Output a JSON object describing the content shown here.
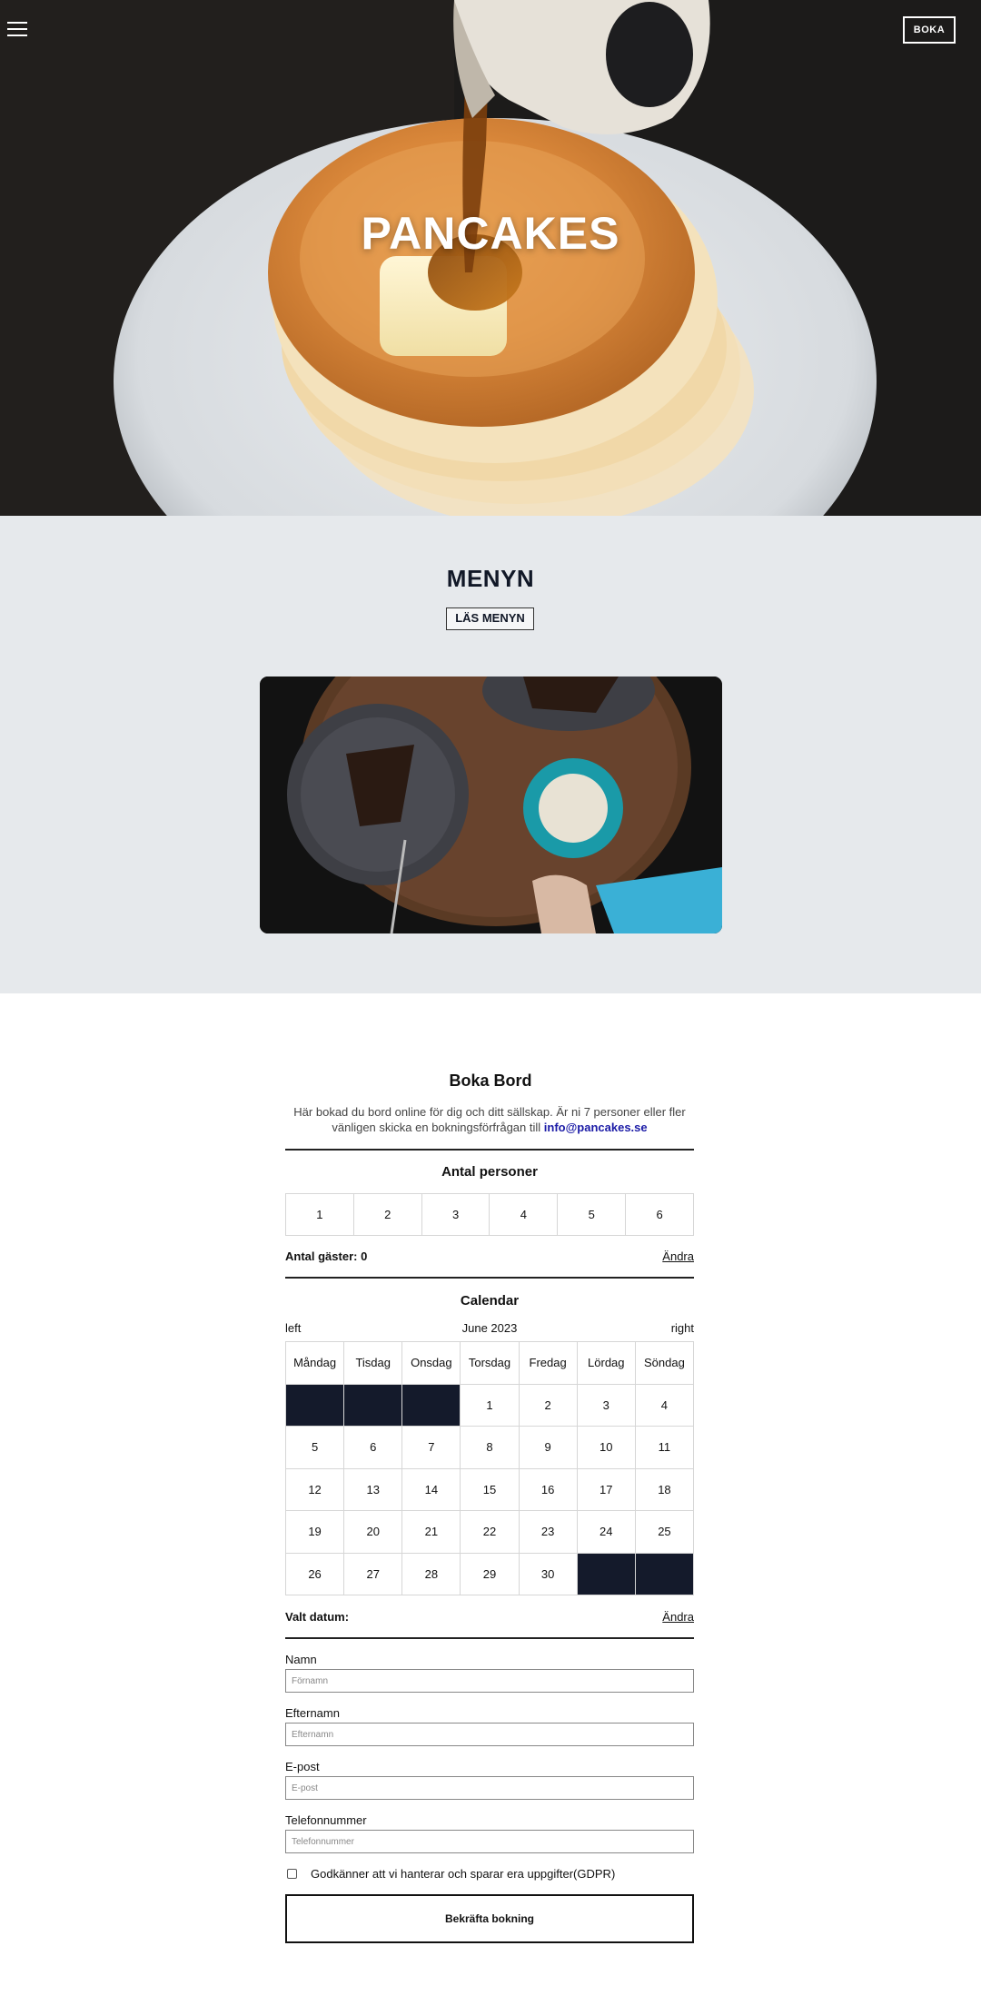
{
  "hero": {
    "title": "PANCAKES",
    "boka_label": "BOKA"
  },
  "menu": {
    "title": "MENYN",
    "button_label": "LÄS MENYN"
  },
  "booking": {
    "title": "Boka Bord",
    "description": "Här bokad du bord online för dig och ditt sällskap. Är ni 7 personer eller fler vänligen skicka en bokningsförfrågan till",
    "email": "info@pancakes.se",
    "persons_heading": "Antal personer",
    "persons": [
      "1",
      "2",
      "3",
      "4",
      "5",
      "6"
    ],
    "guests_label": "Antal gäster: 0",
    "change_label": "Ändra",
    "calendar_heading": "Calendar",
    "nav_left": "left",
    "month": "June 2023",
    "nav_right": "right",
    "weekdays": [
      "Måndag",
      "Tisdag",
      "Onsdag",
      "Torsdag",
      "Fredag",
      "Lördag",
      "Söndag"
    ],
    "days": [
      "1",
      "2",
      "3",
      "4",
      "5",
      "6",
      "7",
      "8",
      "9",
      "10",
      "11",
      "12",
      "13",
      "14",
      "15",
      "16",
      "17",
      "18",
      "19",
      "20",
      "21",
      "22",
      "23",
      "24",
      "25",
      "26",
      "27",
      "28",
      "29",
      "30"
    ],
    "selected_date_label": "Valt datum:",
    "change_date_label": "Ändra",
    "fields": [
      {
        "label": "Namn",
        "placeholder": "Förnamn"
      },
      {
        "label": "Efternamn",
        "placeholder": "Efternamn"
      },
      {
        "label": "E-post",
        "placeholder": "E-post"
      },
      {
        "label": "Telefonnummer",
        "placeholder": "Telefonnummer"
      }
    ],
    "gdpr_label": "Godkänner att vi hanterar och sparar era uppgifter(GDPR)",
    "confirm_label": "Bekräfta bokning"
  },
  "colors": {
    "menu_bg": "#e6e9ec",
    "calendar_blank": "#141a2b",
    "email_link": "#1a1aa6"
  }
}
